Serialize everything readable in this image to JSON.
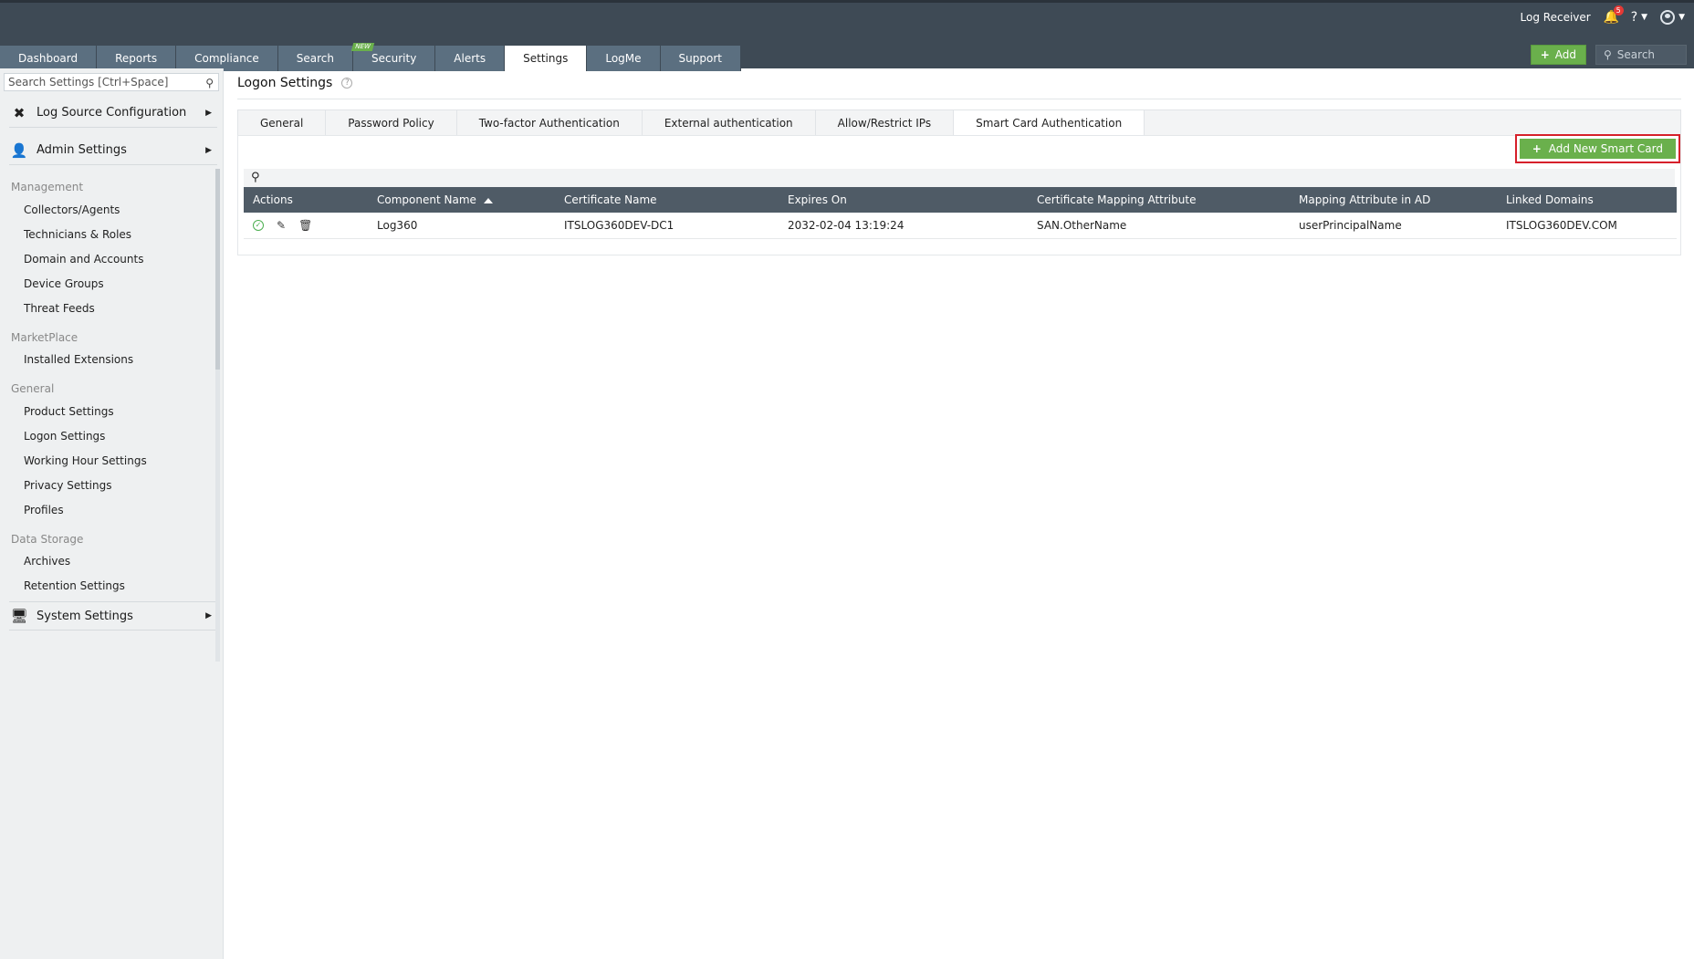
{
  "header": {
    "account_label": "Log Receiver",
    "notification_count": "5",
    "help_label": "?",
    "add_label": "Add",
    "search_placeholder": "Search"
  },
  "nav": {
    "tabs": [
      {
        "label": "Dashboard"
      },
      {
        "label": "Reports"
      },
      {
        "label": "Compliance"
      },
      {
        "label": "Search"
      },
      {
        "label": "Security",
        "badge": "NEW"
      },
      {
        "label": "Alerts"
      },
      {
        "label": "Settings",
        "active": true
      },
      {
        "label": "LogMe"
      },
      {
        "label": "Support"
      }
    ]
  },
  "sidebar": {
    "search_placeholder": "Search Settings [Ctrl+Space]",
    "sections": {
      "log_source": "Log Source Configuration",
      "admin": "Admin Settings",
      "system": "System Settings"
    },
    "categories": {
      "management": "Management",
      "marketplace": "MarketPlace",
      "general": "General",
      "data_storage": "Data Storage"
    },
    "items": {
      "collectors": "Collectors/Agents",
      "technicians": "Technicians & Roles",
      "domain": "Domain and Accounts",
      "device_groups": "Device Groups",
      "threat_feeds": "Threat Feeds",
      "installed_ext": "Installed Extensions",
      "product_settings": "Product Settings",
      "logon_settings": "Logon Settings",
      "working_hour": "Working Hour Settings",
      "privacy": "Privacy Settings",
      "profiles": "Profiles",
      "archives": "Archives",
      "retention": "Retention Settings"
    }
  },
  "main": {
    "title": "Logon Settings",
    "subtabs": [
      {
        "label": "General"
      },
      {
        "label": "Password Policy"
      },
      {
        "label": "Two-factor Authentication"
      },
      {
        "label": "External authentication"
      },
      {
        "label": "Allow/Restrict IPs"
      },
      {
        "label": "Smart Card Authentication",
        "active": true
      }
    ],
    "add_button": "Add New Smart Card",
    "table": {
      "headers": [
        "Actions",
        "Component Name",
        "Certificate Name",
        "Expires On",
        "Certificate Mapping Attribute",
        "Mapping Attribute in AD",
        "Linked Domains"
      ],
      "rows": [
        {
          "component": "Log360",
          "certificate": "ITSLOG360DEV-DC1",
          "expires": "2032-02-04 13:19:24",
          "mapping_attr": "SAN.OtherName",
          "mapping_ad": "userPrincipalName",
          "domains": "ITSLOG360DEV.COM"
        }
      ]
    }
  },
  "colors": {
    "topbar": "#3e4a55",
    "tab_bg": "#5b6f80",
    "accent_green": "#6ab04c",
    "highlight_red": "#d6202a",
    "table_header": "#4f5b66"
  }
}
